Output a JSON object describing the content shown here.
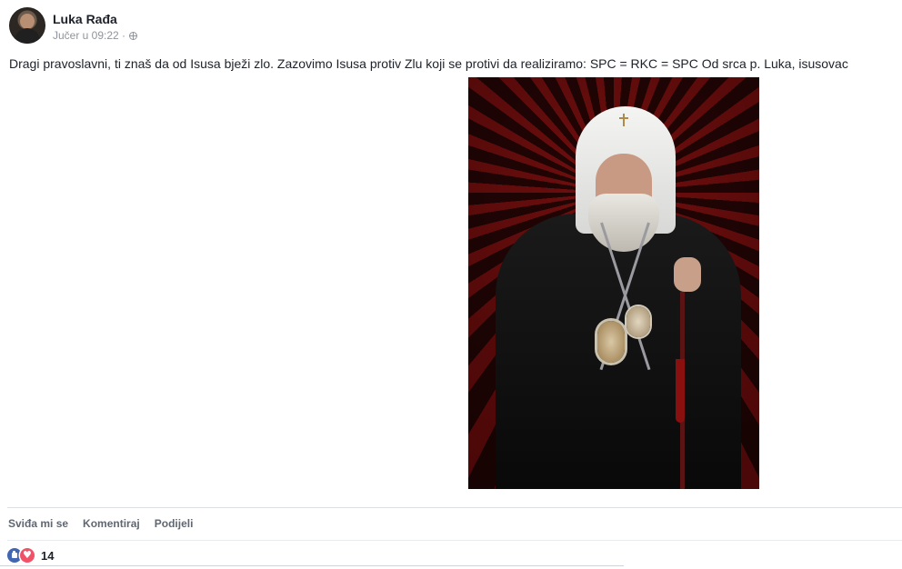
{
  "post": {
    "author": "Luka Rađa",
    "time": "Jučer u 09:22 ·",
    "text": "Dragi pravoslavni, ti znaš da od Isusa bježi zlo. Zazovimo Isusa protiv Zlu koji se protivi da realiziramo: SPC = RKC = SPC Od srca p. Luka, isusovac"
  },
  "actions": {
    "like": "Sviđa mi se",
    "comment": "Komentiraj",
    "share": "Podijeli"
  },
  "reactions": {
    "count": "14",
    "icons": [
      "like-icon",
      "love-icon"
    ],
    "colors": {
      "like": "#4267b2",
      "love": "#f25268"
    }
  }
}
